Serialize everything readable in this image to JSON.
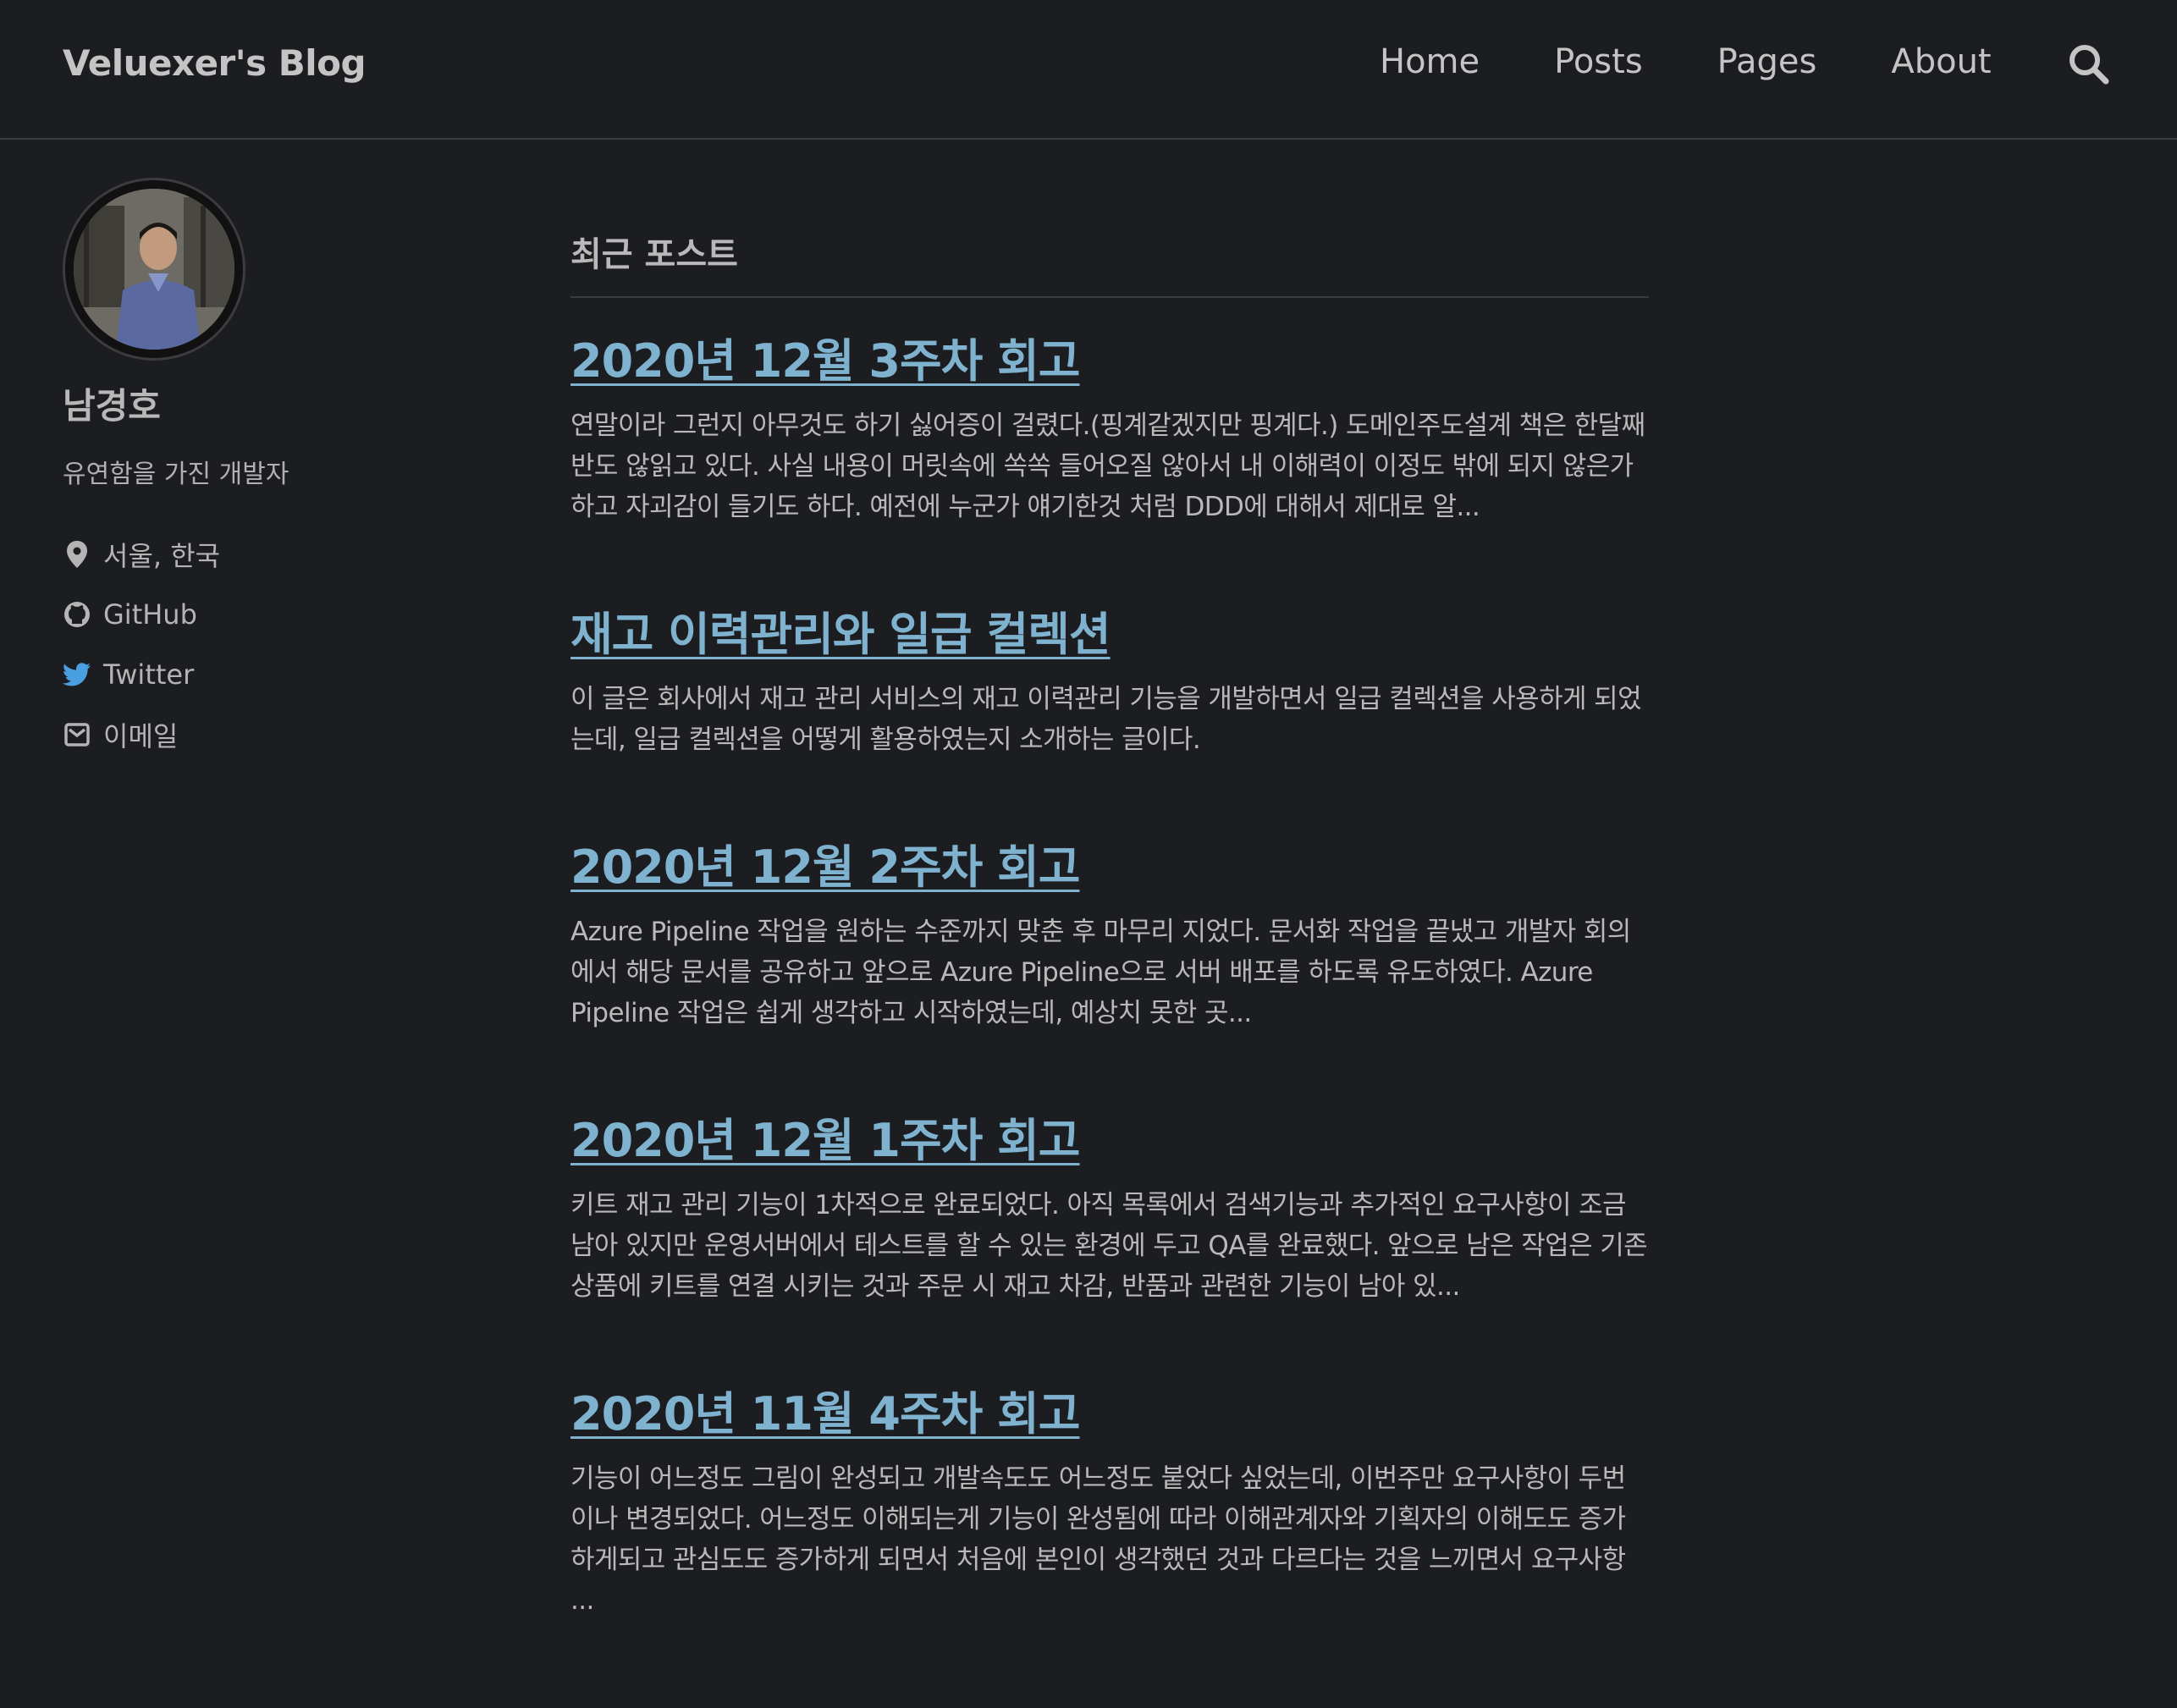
{
  "header": {
    "site_title": "Veluexer's Blog",
    "nav": [
      {
        "label": "Home"
      },
      {
        "label": "Posts"
      },
      {
        "label": "Pages"
      },
      {
        "label": "About"
      }
    ],
    "search_icon": "search-icon"
  },
  "sidebar": {
    "avatar_icon": "avatar",
    "name": "남경호",
    "bio": "유연함을 가진 개발자",
    "links": [
      {
        "icon": "location-pin-icon",
        "label": "서울, 한국"
      },
      {
        "icon": "github-icon",
        "label": "GitHub"
      },
      {
        "icon": "twitter-icon",
        "label": "Twitter",
        "color": "#4a9fe0"
      },
      {
        "icon": "email-icon",
        "label": "이메일"
      }
    ]
  },
  "main": {
    "section_title": "최근 포스트",
    "posts": [
      {
        "title": "2020년 12월 3주차 회고",
        "excerpt": "연말이라 그런지 아무것도 하기 싫어증이 걸렸다.(핑계같겠지만 핑계다.) 도메인주도설계 책은 한달째 반도 않읽고 있다. 사실 내용이 머릿속에 쏙쏙 들어오질 않아서 내 이해력이 이정도 밖에 되지 않은가 하고 자괴감이 들기도 하다. 예전에 누군가 얘기한것 처럼 DDD에 대해서 제대로 알..."
      },
      {
        "title": "재고 이력관리와 일급 컬렉션",
        "excerpt": "이 글은 회사에서 재고 관리 서비스의 재고 이력관리 기능을 개발하면서 일급 컬렉션을 사용하게 되었는데, 일급 컬렉션을 어떻게 활용하였는지 소개하는 글이다."
      },
      {
        "title": "2020년 12월 2주차 회고",
        "excerpt": "Azure Pipeline 작업을 원하는 수준까지 맞춘 후 마무리 지었다. 문서화 작업을 끝냈고 개발자 회의에서 해당 문서를 공유하고 앞으로 Azure Pipeline으로 서버 배포를 하도록 유도하였다. Azure Pipeline 작업은 쉽게 생각하고 시작하였는데, 예상치 못한 곳..."
      },
      {
        "title": "2020년 12월 1주차 회고",
        "excerpt": "키트 재고 관리 기능이 1차적으로 완료되었다. 아직 목록에서 검색기능과 추가적인 요구사항이 조금 남아 있지만 운영서버에서 테스트를 할 수 있는 환경에 두고 QA를 완료했다. 앞으로 남은 작업은 기존 상품에 키트를 연결 시키는 것과 주문 시 재고 차감, 반품과 관련한 기능이 남아 있..."
      },
      {
        "title": "2020년 11월 4주차 회고",
        "excerpt": "기능이 어느정도 그림이 완성되고 개발속도도 어느정도 붙었다 싶었는데, 이번주만 요구사항이 두번이나 변경되었다. 어느정도 이해되는게 기능이 완성됨에 따라 이해관계자와 기획자의 이해도도 증가하게되고 관심도도 증가하게 되면서 처음에 본인이 생각했던 것과 다르다는 것을 느끼면서 요구사항 ..."
      }
    ]
  }
}
